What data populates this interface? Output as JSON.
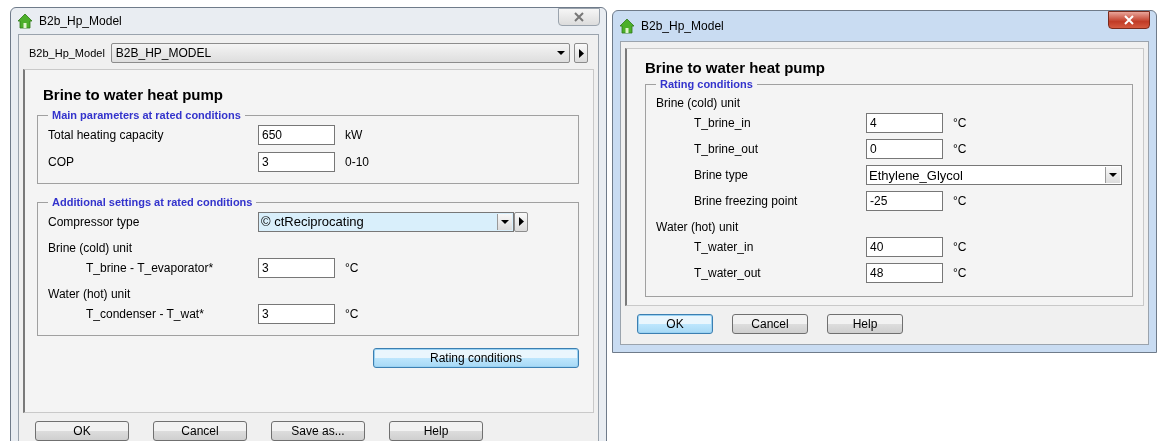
{
  "windows": [
    {
      "title": "B2b_Hp_Model",
      "active": false,
      "model_row": {
        "label": "B2b_Hp_Model",
        "value": "B2B_HP_MODEL"
      },
      "heading": "Brine to water heat pump",
      "groups": [
        {
          "title": "Main parameters at rated conditions",
          "rows": [
            {
              "kind": "field",
              "label": "Total heating capacity",
              "value": "650",
              "unit": "kW"
            },
            {
              "kind": "field",
              "label": "COP",
              "value": "3",
              "unit": "0-10"
            }
          ]
        },
        {
          "title": "Additional settings at rated conditions",
          "rows": [
            {
              "kind": "select",
              "label": "Compressor type",
              "value": "© ctReciprocating",
              "highlighted": true,
              "more": true
            },
            {
              "kind": "section",
              "label": "Brine (cold) unit",
              "children": [
                {
                  "kind": "field",
                  "label": "T_brine - T_evaporator*",
                  "value": "3",
                  "unit": "°C"
                }
              ]
            },
            {
              "kind": "section",
              "label": "Water (hot) unit",
              "children": [
                {
                  "kind": "field",
                  "label": "T_condenser - T_wat*",
                  "value": "3",
                  "unit": "°C"
                }
              ]
            }
          ]
        }
      ],
      "action_button": {
        "label": "Rating conditions",
        "focused": true
      },
      "buttons": [
        {
          "label": "OK",
          "focused": false
        },
        {
          "label": "Cancel",
          "focused": false
        },
        {
          "label": "Save as...",
          "focused": false
        },
        {
          "label": "Help",
          "focused": false
        }
      ]
    },
    {
      "title": "B2b_Hp_Model",
      "active": true,
      "heading": "Brine to water heat pump",
      "groups": [
        {
          "title": "Rating conditions",
          "rows": [
            {
              "kind": "section",
              "label": "Brine (cold) unit",
              "children": [
                {
                  "kind": "field",
                  "label": "T_brine_in",
                  "value": "4",
                  "unit": "°C"
                },
                {
                  "kind": "field",
                  "label": "T_brine_out",
                  "value": "0",
                  "unit": "°C"
                },
                {
                  "kind": "select",
                  "label": "Brine type",
                  "value": "Ethylene_Glycol",
                  "highlighted": false,
                  "more": false
                },
                {
                  "kind": "field",
                  "label": "Brine freezing point",
                  "value": "-25",
                  "unit": "°C"
                }
              ]
            },
            {
              "kind": "section",
              "label": "Water (hot) unit",
              "children": [
                {
                  "kind": "field",
                  "label": "T_water_in",
                  "value": "40",
                  "unit": "°C"
                },
                {
                  "kind": "field",
                  "label": "T_water_out",
                  "value": "48",
                  "unit": "°C"
                }
              ]
            }
          ]
        }
      ],
      "buttons": [
        {
          "label": "OK",
          "focused": true
        },
        {
          "label": "Cancel",
          "focused": false
        },
        {
          "label": "Help",
          "focused": false
        }
      ]
    }
  ]
}
